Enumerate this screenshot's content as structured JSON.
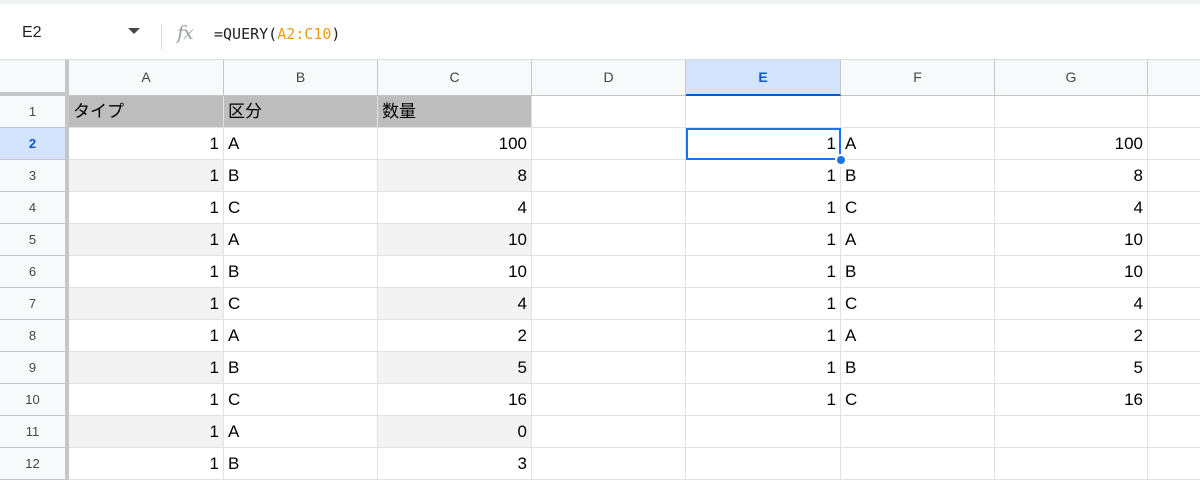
{
  "name_box": {
    "value": "E2"
  },
  "formula": {
    "prefix": "=QUERY(",
    "range": "A2:C10",
    "suffix": ")"
  },
  "columns": [
    "A",
    "B",
    "C",
    "D",
    "E",
    "F",
    "G"
  ],
  "selected_column": "E",
  "selected_row": "2",
  "rows": [
    {
      "n": "1",
      "a": "タイプ",
      "b": "区分",
      "c": "数量",
      "e": "",
      "f": "",
      "g": ""
    },
    {
      "n": "2",
      "a": "1",
      "b": "A",
      "c": "100",
      "e": "1",
      "f": "A",
      "g": "100"
    },
    {
      "n": "3",
      "a": "1",
      "b": "B",
      "c": "8",
      "e": "1",
      "f": "B",
      "g": "8"
    },
    {
      "n": "4",
      "a": "1",
      "b": "C",
      "c": "4",
      "e": "1",
      "f": "C",
      "g": "4"
    },
    {
      "n": "5",
      "a": "1",
      "b": "A",
      "c": "10",
      "e": "1",
      "f": "A",
      "g": "10"
    },
    {
      "n": "6",
      "a": "1",
      "b": "B",
      "c": "10",
      "e": "1",
      "f": "B",
      "g": "10"
    },
    {
      "n": "7",
      "a": "1",
      "b": "C",
      "c": "4",
      "e": "1",
      "f": "C",
      "g": "4"
    },
    {
      "n": "8",
      "a": "1",
      "b": "A",
      "c": "2",
      "e": "1",
      "f": "A",
      "g": "2"
    },
    {
      "n": "9",
      "a": "1",
      "b": "B",
      "c": "5",
      "e": "1",
      "f": "B",
      "g": "5"
    },
    {
      "n": "10",
      "a": "1",
      "b": "C",
      "c": "16",
      "e": "1",
      "f": "C",
      "g": "16"
    },
    {
      "n": "11",
      "a": "1",
      "b": "A",
      "c": "0",
      "e": "",
      "f": "",
      "g": ""
    },
    {
      "n": "12",
      "a": "1",
      "b": "B",
      "c": "3",
      "e": "",
      "f": "",
      "g": ""
    }
  ],
  "colors": {
    "selection": "#1a73e8",
    "header_fill": "#bdbdbd",
    "band_fill": "#f3f3f3",
    "formula_ref": "#f09a1a"
  }
}
